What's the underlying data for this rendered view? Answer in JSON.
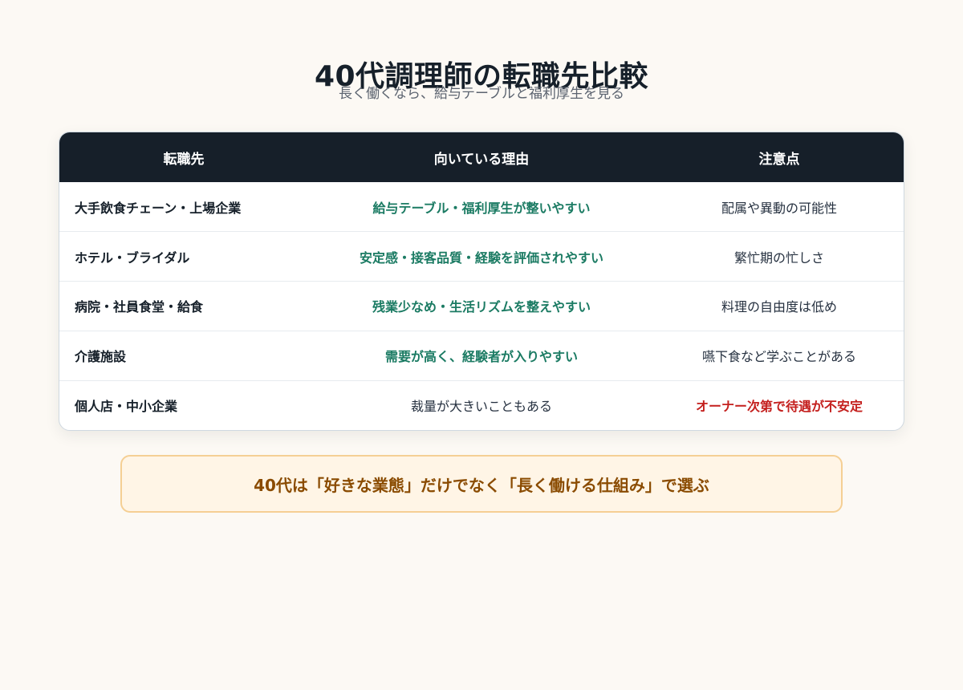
{
  "header": {
    "title": "40代調理師の転職先比較",
    "subtitle": "長く働くなら、給与テーブルと福利厚生を見る"
  },
  "table": {
    "columns": [
      "転職先",
      "向いている理由",
      "注意点"
    ],
    "rows": [
      {
        "destination": "大手飲食チェーン・上場企業",
        "reason": "給与テーブル・福利厚生が整いやすい",
        "caution": "配属や異動の可能性"
      },
      {
        "destination": "ホテル・ブライダル",
        "reason": "安定感・接客品質・経験を評価されやすい",
        "caution": "繁忙期の忙しさ"
      },
      {
        "destination": "病院・社員食堂・給食",
        "reason": "残業少なめ・生活リズムを整えやすい",
        "caution": "料理の自由度は低め"
      },
      {
        "destination": "介護施設",
        "reason": "需要が高く、経験者が入りやすい",
        "caution": "嚥下食など学ぶことがある"
      },
      {
        "destination": "個人店・中小企業",
        "reason": "裁量が大きいこともある",
        "caution": "オーナー次第で待遇が不安定"
      }
    ]
  },
  "callout": {
    "text": "40代は「好きな業態」だけでなく「長く働ける仕組み」で選ぶ"
  },
  "colors": {
    "header_bg": "#161f29",
    "positive": "#1b7b63",
    "warning": "#c4201e",
    "callout_text": "#8a4b00",
    "callout_bg": "#fff5e6",
    "callout_border": "#f5cf94",
    "page_bg": "#fcf9f4"
  }
}
